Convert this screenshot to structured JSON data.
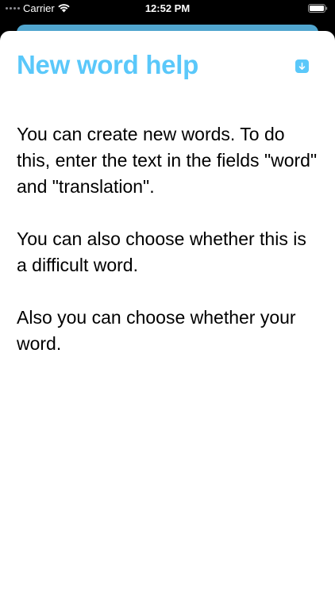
{
  "status_bar": {
    "carrier": "Carrier",
    "time": "12:52 PM"
  },
  "sheet": {
    "title": "New word help",
    "action_icon": "arrow-down-square-icon",
    "paragraphs": [
      "You can create new words. To do this, enter the text in the fields \"word\" and \"translation\".",
      "You can also choose whether this is a difficult word.",
      "Also you can choose whether your word."
    ]
  },
  "colors": {
    "accent": "#5ac8fa",
    "background_sheet": "#5ab8e6",
    "status_background": "#000000"
  }
}
